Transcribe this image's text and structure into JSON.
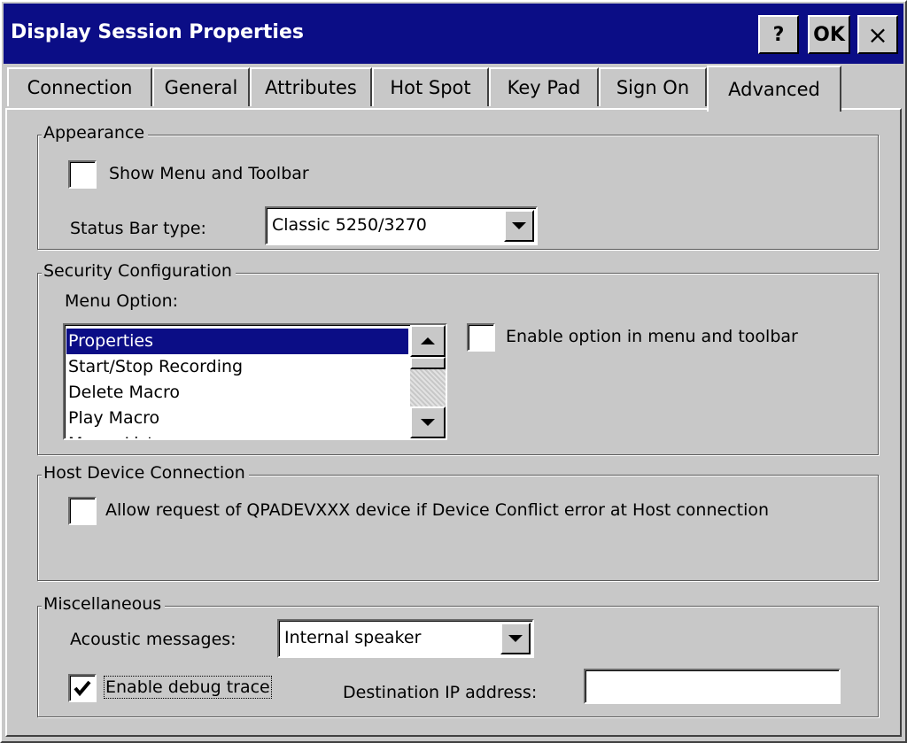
{
  "window": {
    "title": "Display Session Properties",
    "help_label": "?",
    "ok_label": "OK",
    "close_label": "×"
  },
  "tabs": [
    {
      "label": "Connection",
      "active": false
    },
    {
      "label": "General",
      "active": false
    },
    {
      "label": "Attributes",
      "active": false
    },
    {
      "label": "Hot Spot",
      "active": false
    },
    {
      "label": "Key Pad",
      "active": false
    },
    {
      "label": "Sign On",
      "active": false
    },
    {
      "label": "Advanced",
      "active": true
    }
  ],
  "appearance": {
    "group_label": "Appearance",
    "show_menu_label": "Show Menu and Toolbar",
    "show_menu_checked": false,
    "status_bar_label": "Status Bar type:",
    "status_bar_value": "Classic 5250/3270"
  },
  "security": {
    "group_label": "Security Configuration",
    "menu_option_label": "Menu Option:",
    "menu_items": [
      "Properties",
      "Start/Stop Recording",
      "Delete Macro",
      "Play Macro",
      "Macro List"
    ],
    "selected_item": "Properties",
    "enable_option_label": "Enable option in menu and toolbar",
    "enable_option_checked": false
  },
  "host": {
    "group_label": "Host Device Connection",
    "allow_request_label": "Allow request of QPADEVXXX device if Device Conflict error at Host connection",
    "allow_request_checked": false
  },
  "misc": {
    "group_label": "Miscellaneous",
    "acoustic_label": "Acoustic messages:",
    "acoustic_value": "Internal speaker",
    "debug_label": "Enable debug trace",
    "debug_checked": true,
    "dest_ip_label": "Destination IP address:",
    "dest_ip_value": ""
  },
  "colors": {
    "titlebar": "#0b0d86",
    "face": "#c8c8c8",
    "selection": "#0b0d86"
  },
  "icons": {
    "dropdown": "chevron-down-icon",
    "scroll_up": "arrow-up-icon",
    "scroll_down": "arrow-down-icon",
    "check": "checkmark-icon"
  }
}
